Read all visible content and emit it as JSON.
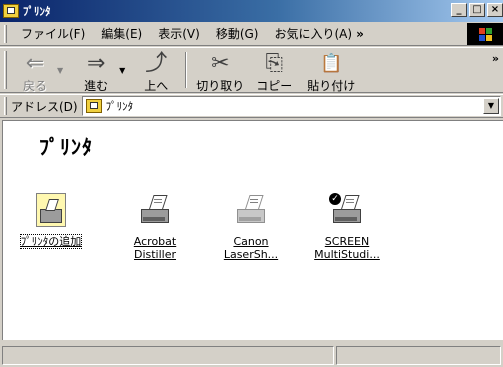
{
  "window": {
    "title": "ﾌﾟﾘﾝﾀ",
    "controls": {
      "minimize": "_",
      "maximize": "□",
      "close": "×"
    }
  },
  "menu": {
    "items": [
      "ファイル(F)",
      "編集(E)",
      "表示(V)",
      "移動(G)",
      "お気に入り(A)"
    ],
    "overflow": "»"
  },
  "toolbar": {
    "buttons": [
      {
        "label": "戻る",
        "icon": "back-arrow-icon",
        "glyph": "⇐",
        "enabled": false,
        "dropdown": true
      },
      {
        "label": "進む",
        "icon": "forward-arrow-icon",
        "glyph": "⇒",
        "enabled": true,
        "dropdown": true
      },
      {
        "label": "上へ",
        "icon": "up-folder-icon",
        "glyph": "⤴",
        "enabled": true
      },
      {
        "label": "切り取り",
        "icon": "scissors-icon",
        "glyph": "✂",
        "enabled": true
      },
      {
        "label": "コピー",
        "icon": "copy-icon",
        "glyph": "⎘",
        "enabled": true
      },
      {
        "label": "貼り付け",
        "icon": "paste-icon",
        "glyph": "📋",
        "enabled": true
      }
    ],
    "overflow": "»"
  },
  "address": {
    "label": "アドレス(D)",
    "value": "ﾌﾟﾘﾝﾀ"
  },
  "content": {
    "folder_title": "ﾌﾟﾘﾝﾀ",
    "items": [
      {
        "name_line1": "ﾌﾟﾘﾝﾀの追加",
        "name_line2": "",
        "icon": "add-printer-icon"
      },
      {
        "name_line1": "Acrobat",
        "name_line2": "Distiller",
        "icon": "printer-icon"
      },
      {
        "name_line1": "Canon",
        "name_line2": "LaserSh...",
        "icon": "printer-icon"
      },
      {
        "name_line1": "SCREEN",
        "name_line2": "MultiStudi...",
        "icon": "default-printer-icon"
      }
    ]
  },
  "colors": {
    "title_start": "#0a246a",
    "title_end": "#a6caf0",
    "face": "#d4d0c8"
  }
}
